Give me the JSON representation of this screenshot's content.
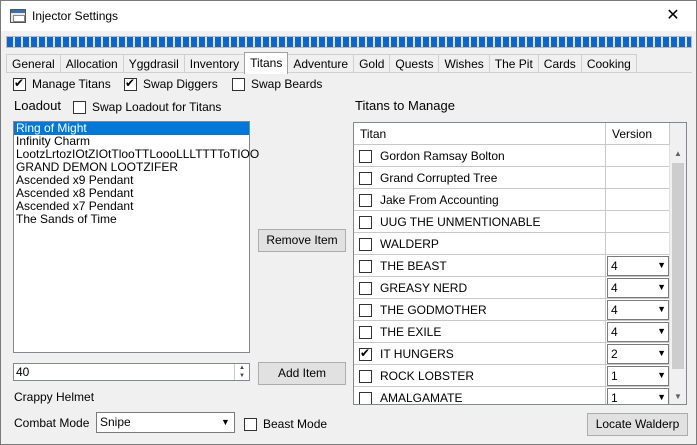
{
  "window": {
    "title": "Injector Settings",
    "close_glyph": "✕"
  },
  "progress": {
    "fraction": 1.0
  },
  "tabs": [
    {
      "label": "General",
      "active": false
    },
    {
      "label": "Allocation",
      "active": false
    },
    {
      "label": "Yggdrasil",
      "active": false
    },
    {
      "label": "Inventory",
      "active": false
    },
    {
      "label": "Titans",
      "active": true
    },
    {
      "label": "Adventure",
      "active": false
    },
    {
      "label": "Gold",
      "active": false
    },
    {
      "label": "Quests",
      "active": false
    },
    {
      "label": "Wishes",
      "active": false
    },
    {
      "label": "The Pit",
      "active": false
    },
    {
      "label": "Cards",
      "active": false
    },
    {
      "label": "Cooking",
      "active": false
    }
  ],
  "options": {
    "manage_titans": {
      "label": "Manage Titans",
      "checked": true
    },
    "swap_diggers": {
      "label": "Swap Diggers",
      "checked": true
    },
    "swap_beards": {
      "label": "Swap Beards",
      "checked": false
    }
  },
  "loadout": {
    "heading": "Loadout",
    "swap_for_titans": {
      "label": "Swap Loadout for Titans",
      "checked": false
    },
    "items": [
      {
        "label": "Ring of Might",
        "selected": true
      },
      {
        "label": "Infinity Charm",
        "selected": false
      },
      {
        "label": "LootzLrtozIOtZIOtTlooTTLoooLLLTTTToTIOO",
        "selected": false
      },
      {
        "label": "GRAND DEMON LOOTZIFER",
        "selected": false
      },
      {
        "label": "Ascended x9 Pendant",
        "selected": false
      },
      {
        "label": "Ascended x8 Pendant",
        "selected": false
      },
      {
        "label": "Ascended x7 Pendant",
        "selected": false
      },
      {
        "label": "The Sands of Time",
        "selected": false
      }
    ],
    "remove_button": "Remove Item",
    "add_button": "Add Item",
    "item_id_value": "40",
    "item_name": "Crappy Helmet"
  },
  "combat": {
    "label": "Combat Mode",
    "value": "Snipe",
    "beast_mode": {
      "label": "Beast Mode",
      "checked": false
    }
  },
  "titans": {
    "heading": "Titans to Manage",
    "columns": {
      "titan": "Titan",
      "version": "Version"
    },
    "rows": [
      {
        "name": "Gordon Ramsay Bolton",
        "checked": false,
        "version": ""
      },
      {
        "name": "Grand Corrupted Tree",
        "checked": false,
        "version": ""
      },
      {
        "name": "Jake From Accounting",
        "checked": false,
        "version": ""
      },
      {
        "name": "UUG THE UNMENTIONABLE",
        "checked": false,
        "version": ""
      },
      {
        "name": "WALDERP",
        "checked": false,
        "version": ""
      },
      {
        "name": "THE BEAST",
        "checked": false,
        "version": "4"
      },
      {
        "name": "GREASY NERD",
        "checked": false,
        "version": "4"
      },
      {
        "name": "THE GODMOTHER",
        "checked": false,
        "version": "4"
      },
      {
        "name": "THE EXILE",
        "checked": false,
        "version": "4"
      },
      {
        "name": "IT HUNGERS",
        "checked": true,
        "version": "2"
      },
      {
        "name": "ROCK LOBSTER",
        "checked": false,
        "version": "1"
      },
      {
        "name": "AMALGAMATE",
        "checked": false,
        "version": "1"
      }
    ],
    "locate_button": "Locate Walderp"
  }
}
